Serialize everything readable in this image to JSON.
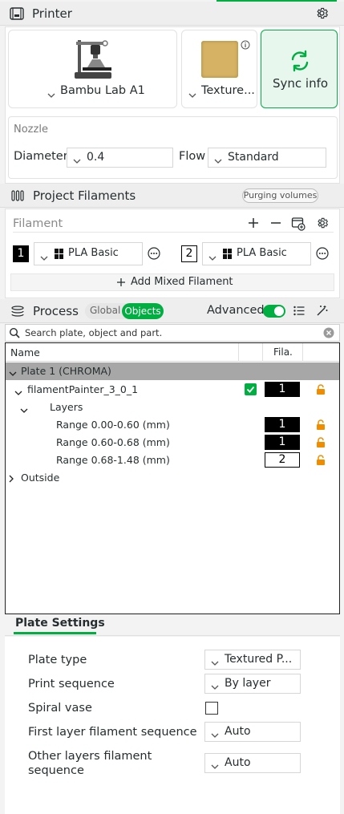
{
  "printer": {
    "title": "Printer",
    "printer_name": "Bambu Lab A1",
    "plate_name": "Texture...",
    "sync_label": "Sync info"
  },
  "nozzle": {
    "section_label": "Nozzle",
    "diameter_label": "Diameter",
    "diameter_value": "0.4",
    "flow_label": "Flow",
    "flow_value": "Standard"
  },
  "filaments": {
    "title": "Project Filaments",
    "purging_label": "Purging volumes",
    "filament_label": "Filament",
    "items": [
      {
        "index": "1",
        "name": "PLA Basic"
      },
      {
        "index": "2",
        "name": "PLA Basic"
      }
    ],
    "add_mixed_label": "Add Mixed Filament"
  },
  "process": {
    "title": "Process",
    "global_label": "Global",
    "objects_label": "Objects",
    "advanced_label": "Advanced",
    "advanced_on": true,
    "search_placeholder": "Search plate, object and part."
  },
  "tree": {
    "col_name": "Name",
    "col_fila": "Fila.",
    "plate_row": "Plate 1 (CHROMA)",
    "object_row": {
      "label": "filamentPainter_3_0_1",
      "filament": "1"
    },
    "layers_row": "Layers",
    "ranges": [
      {
        "label": "Range 0.00-0.60 (mm)",
        "filament": "1"
      },
      {
        "label": "Range 0.60-0.68 (mm)",
        "filament": "1"
      },
      {
        "label": "Range 0.68-1.48 (mm)",
        "filament": "2"
      }
    ],
    "outside_row": "Outside"
  },
  "plate_settings": {
    "tab_label": "Plate Settings",
    "plate_type_label": "Plate type",
    "plate_type_value": "Textured P...",
    "print_sequence_label": "Print sequence",
    "print_sequence_value": "By layer",
    "spiral_vase_label": "Spiral vase",
    "spiral_vase_checked": false,
    "first_layer_label": "First layer filament sequence",
    "first_layer_value": "Auto",
    "other_layers_label_1": "Other layers filament",
    "other_layers_label_2": "sequence",
    "other_layers_value": "Auto"
  },
  "colors": {
    "accent": "#00ae42",
    "lock": "#f08c00"
  }
}
